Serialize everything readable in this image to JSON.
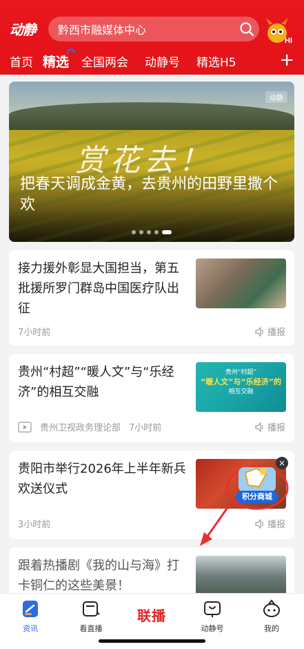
{
  "header": {
    "logo": "动静",
    "search_text": "黔西市融媒体中心",
    "tabs": [
      {
        "label": "首页"
      },
      {
        "label": "精选"
      },
      {
        "label": "全国两会"
      },
      {
        "label": "动静号"
      },
      {
        "label": "精选H5"
      }
    ],
    "plus": "+"
  },
  "hero": {
    "calligraphy": "赏花去！",
    "watermark": "动静",
    "title": "把春天调成金黄，去贵州的田野里撒个欢",
    "dots": 5,
    "active_dot": 5
  },
  "articles": [
    {
      "title": "接力援外彰显大国担当，第五批援所罗门群岛中国医疗队出征",
      "time": "7小时前",
      "source": "",
      "broadcast": "播报"
    },
    {
      "title": "贵州“村超”“暖人文”与“乐经济”的相互交融",
      "time": "7小时前",
      "source": "贵州卫视政务理论部",
      "broadcast": "播报",
      "thumb_lines": [
        "贵州“村超”",
        "“暖人文”与“乐经济”的",
        "相互交融"
      ]
    },
    {
      "title": "贵阳市举行2026年上半年新兵欢送仪式",
      "time": "3小时前",
      "source": "",
      "broadcast": "播报"
    },
    {
      "title": "跟着热播剧《我的山与海》打卡铜仁的这些美景！",
      "time": "",
      "source": "",
      "broadcast": ""
    }
  ],
  "badge": {
    "label": "积分商城"
  },
  "bottom_nav": {
    "items": [
      {
        "label": "资讯"
      },
      {
        "label": "看直播"
      },
      {
        "label": "联播"
      },
      {
        "label": "动静号"
      },
      {
        "label": "我的"
      }
    ]
  },
  "colors": {
    "brand_red": "#e5141b",
    "active_blue": "#2f6be0",
    "muted_text": "#999999"
  }
}
